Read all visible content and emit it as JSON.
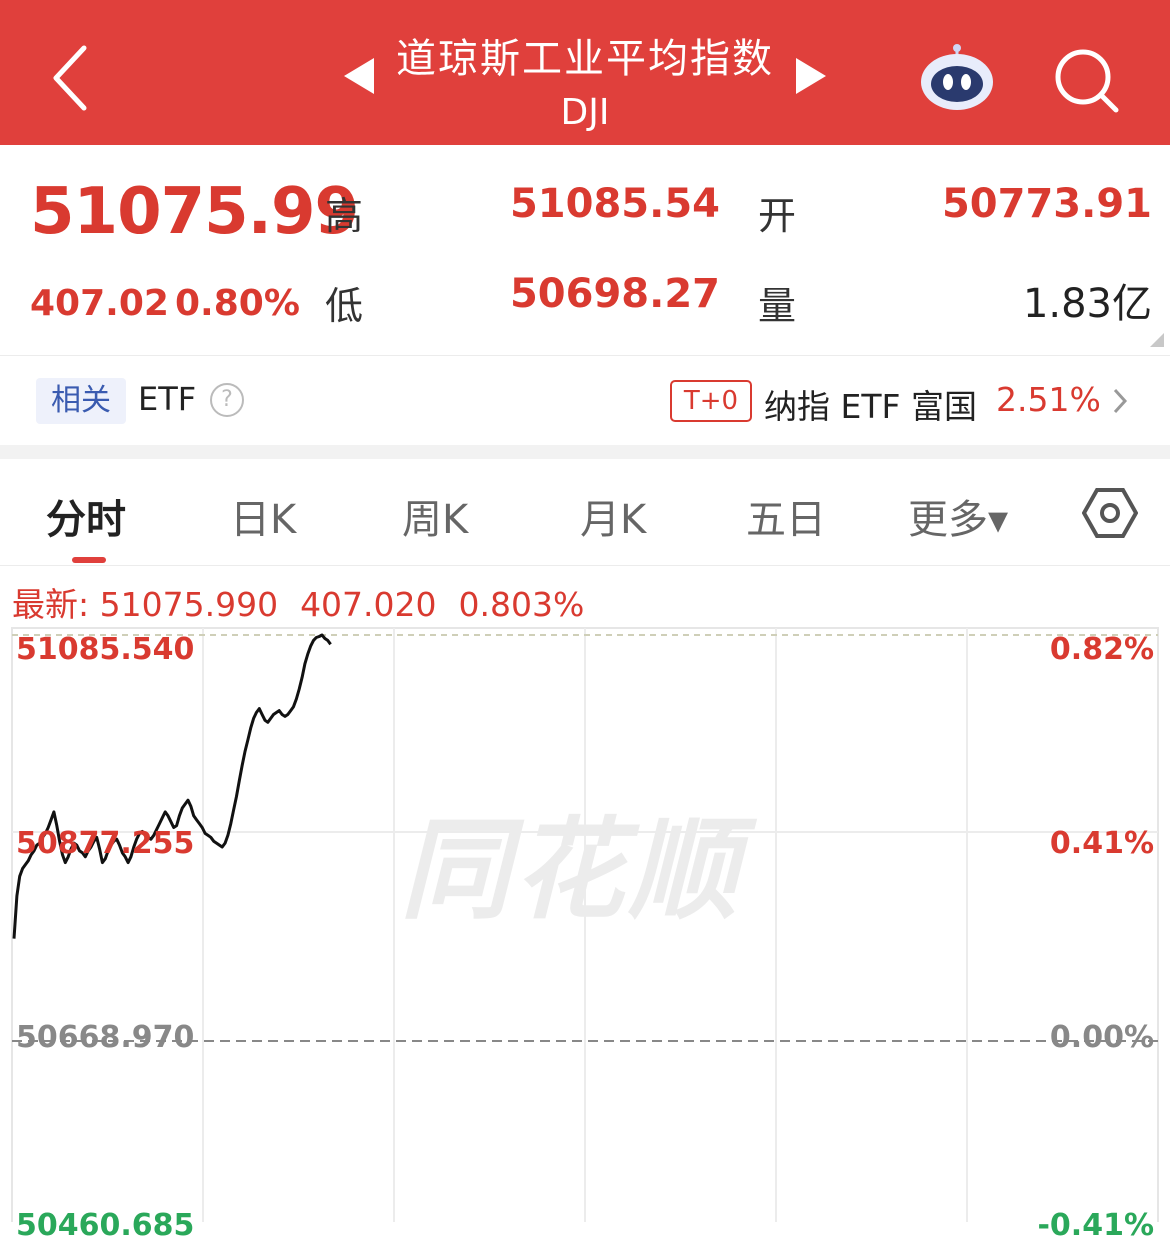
{
  "header": {
    "title": "道琼斯工业平均指数",
    "code": "DJI",
    "bg_color": "#e0403c"
  },
  "quote": {
    "price": "51075.99",
    "change": "407.02",
    "change_pct": "0.80%",
    "high_label": "高",
    "high": "51085.54",
    "low_label": "低",
    "low": "50698.27",
    "open_label": "开",
    "open": "50773.91",
    "volume_label": "量",
    "volume": "1.83亿"
  },
  "etf": {
    "tag": "相关",
    "label": "ETF",
    "help": "?",
    "badge": "T+0",
    "name": "纳指 ETF 富国",
    "pct": "2.51%"
  },
  "tabs": [
    {
      "label": "分时",
      "active": true
    },
    {
      "label": "日K"
    },
    {
      "label": "周K"
    },
    {
      "label": "月K"
    },
    {
      "label": "五日"
    },
    {
      "label": "更多▾"
    }
  ],
  "latest": {
    "prefix": "最新: 51075.990",
    "change": "407.020",
    "pct": "0.803%"
  },
  "chart_data": {
    "type": "line",
    "title": "",
    "y_left_ticks": [
      "51085.540",
      "50877.255",
      "50668.970",
      "50460.685"
    ],
    "y_right_ticks": [
      "0.82%",
      "0.41%",
      "0.00%",
      "-0.41%"
    ],
    "ylim": [
      50460.685,
      51085.54
    ],
    "base": 50668.97,
    "x_session_fraction": [
      0,
      0.278
    ],
    "values": [
      50774,
      50818,
      50838,
      50846,
      50850,
      50854,
      50860,
      50864,
      50870,
      50872,
      50878,
      50882,
      50888,
      50896,
      50904,
      50890,
      50874,
      50860,
      50852,
      50858,
      50866,
      50872,
      50870,
      50864,
      50862,
      50858,
      50864,
      50868,
      50874,
      50878,
      50866,
      50852,
      50856,
      50864,
      50870,
      50874,
      50876,
      50870,
      50862,
      50858,
      50852,
      50858,
      50868,
      50876,
      50882,
      50884,
      50880,
      50878,
      50876,
      50880,
      50886,
      50892,
      50898,
      50904,
      50900,
      50894,
      50888,
      50890,
      50900,
      50908,
      50912,
      50916,
      50910,
      50900,
      50896,
      50892,
      50888,
      50882,
      50880,
      50878,
      50874,
      50872,
      50870,
      50868,
      50872,
      50880,
      50892,
      50906,
      50920,
      50936,
      50952,
      50966,
      50978,
      50990,
      51000,
      51006,
      51010,
      51004,
      50998,
      50996,
      51000,
      51004,
      51006,
      51008,
      51004,
      51002,
      51004,
      51008,
      51012,
      51020,
      51030,
      51042,
      51056,
      51066,
      51074,
      51080,
      51083,
      51084,
      51085.54,
      51082,
      51080,
      51076
    ]
  }
}
